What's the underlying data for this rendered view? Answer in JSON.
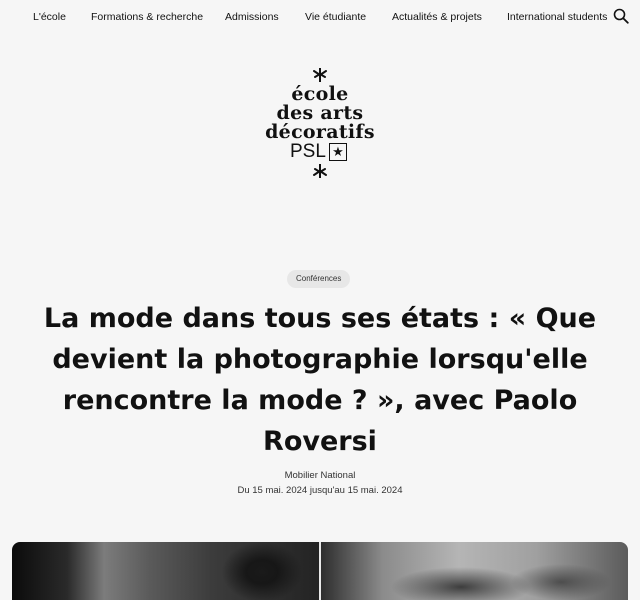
{
  "nav": {
    "items": [
      {
        "label": "L'école"
      },
      {
        "label": "Formations & recherche"
      },
      {
        "label": "Admissions"
      },
      {
        "label": "Vie étudiante"
      },
      {
        "label": "Actualités & projets"
      },
      {
        "label": "International students"
      }
    ],
    "search_icon": "search-icon"
  },
  "logo": {
    "line1": "école",
    "line2": "des arts",
    "line3": "décoratifs",
    "psl": "PSL",
    "star": "★"
  },
  "event": {
    "category": "Conférences",
    "title": "La mode dans tous ses états : « Que devient la photographie lorsqu'elle rencontre la mode ? », avec Paolo Roversi",
    "venue": "Mobilier National",
    "dates": "Du 15 mai. 2024 jusqu'au 15 mai. 2024"
  },
  "colors": {
    "background": "#f6f6f6",
    "text": "#111111",
    "badge_bg": "#e7e7e7"
  }
}
